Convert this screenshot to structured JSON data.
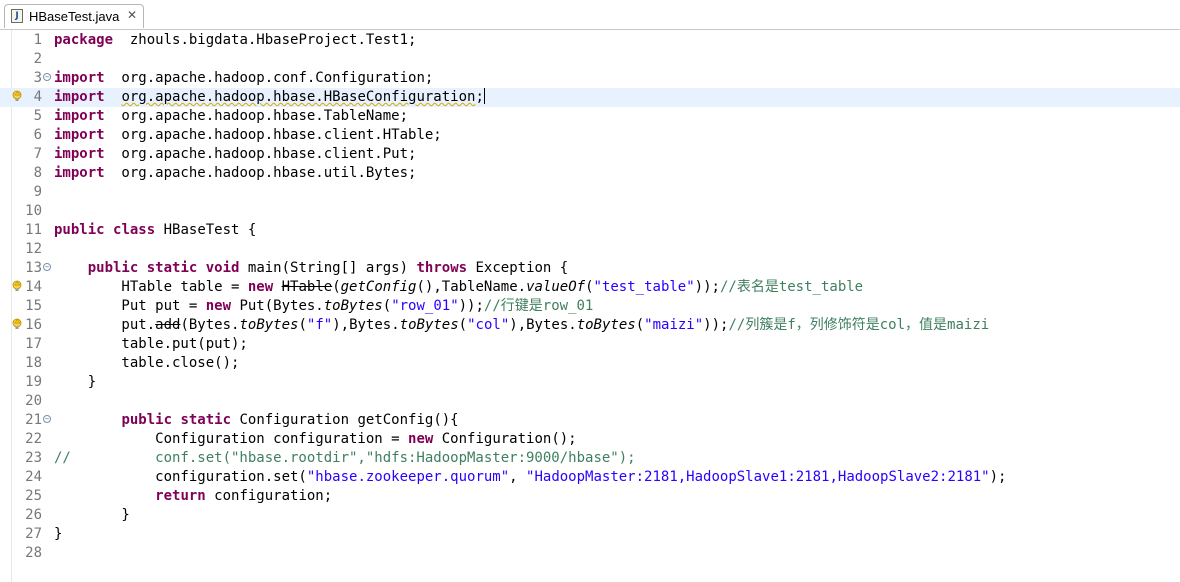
{
  "tab": {
    "title": "HBaseTest.java",
    "close": "✕"
  },
  "lines": [
    {
      "n": "1",
      "parts": [
        [
          "kw",
          "package"
        ],
        [
          "",
          "  zhouls.bigdata.HbaseProject.Test1;"
        ]
      ]
    },
    {
      "n": "2",
      "parts": []
    },
    {
      "n": "3",
      "fold": true,
      "parts": [
        [
          "kw",
          "import"
        ],
        [
          "",
          "  org.apache.hadoop.conf.Configuration;"
        ]
      ]
    },
    {
      "n": "4",
      "warn": true,
      "current": true,
      "parts": [
        [
          "kw",
          "import"
        ],
        [
          "",
          "  "
        ],
        [
          "squig",
          "org.apache.hadoop.hbase.HBaseConfiguration"
        ],
        [
          "",
          ";"
        ],
        [
          "caret",
          ""
        ]
      ]
    },
    {
      "n": "5",
      "parts": [
        [
          "kw",
          "import"
        ],
        [
          "",
          "  org.apache.hadoop.hbase.TableName;"
        ]
      ]
    },
    {
      "n": "6",
      "parts": [
        [
          "kw",
          "import"
        ],
        [
          "",
          "  org.apache.hadoop.hbase.client.HTable;"
        ]
      ]
    },
    {
      "n": "7",
      "parts": [
        [
          "kw",
          "import"
        ],
        [
          "",
          "  org.apache.hadoop.hbase.client.Put;"
        ]
      ]
    },
    {
      "n": "8",
      "parts": [
        [
          "kw",
          "import"
        ],
        [
          "",
          "  org.apache.hadoop.hbase.util.Bytes;"
        ]
      ]
    },
    {
      "n": "9",
      "parts": []
    },
    {
      "n": "10",
      "parts": []
    },
    {
      "n": "11",
      "parts": [
        [
          "kw",
          "public"
        ],
        [
          "",
          " "
        ],
        [
          "kw",
          "class"
        ],
        [
          "",
          " HBaseTest {"
        ]
      ]
    },
    {
      "n": "12",
      "parts": []
    },
    {
      "n": "13",
      "fold": true,
      "parts": [
        [
          "",
          "    "
        ],
        [
          "kw",
          "public"
        ],
        [
          "",
          " "
        ],
        [
          "kw",
          "static"
        ],
        [
          "",
          " "
        ],
        [
          "kw",
          "void"
        ],
        [
          "",
          " main(String[] args) "
        ],
        [
          "kw",
          "throws"
        ],
        [
          "",
          " Exception {"
        ]
      ]
    },
    {
      "n": "14",
      "warn": true,
      "parts": [
        [
          "",
          "        HTable table = "
        ],
        [
          "kw",
          "new"
        ],
        [
          "",
          " "
        ],
        [
          "strike",
          "HTable"
        ],
        [
          "",
          "("
        ],
        [
          "ital",
          "getConfig"
        ],
        [
          "",
          "(),TableName."
        ],
        [
          "ital",
          "valueOf"
        ],
        [
          "",
          "("
        ],
        [
          "str",
          "\"test_table\""
        ],
        [
          "",
          "));"
        ],
        [
          "cm",
          "//表名是test_table"
        ]
      ]
    },
    {
      "n": "15",
      "parts": [
        [
          "",
          "        Put put = "
        ],
        [
          "kw",
          "new"
        ],
        [
          "",
          " Put(Bytes."
        ],
        [
          "ital",
          "toBytes"
        ],
        [
          "",
          "("
        ],
        [
          "str",
          "\"row_01\""
        ],
        [
          "",
          "));"
        ],
        [
          "cm",
          "//行键是row_01"
        ]
      ]
    },
    {
      "n": "16",
      "warn": true,
      "parts": [
        [
          "",
          "        put."
        ],
        [
          "strike",
          "add"
        ],
        [
          "",
          "(Bytes."
        ],
        [
          "ital",
          "toBytes"
        ],
        [
          "",
          "("
        ],
        [
          "str",
          "\"f\""
        ],
        [
          "",
          "),Bytes."
        ],
        [
          "ital",
          "toBytes"
        ],
        [
          "",
          "("
        ],
        [
          "str",
          "\"col\""
        ],
        [
          "",
          "),Bytes."
        ],
        [
          "ital",
          "toBytes"
        ],
        [
          "",
          "("
        ],
        [
          "str",
          "\"maizi\""
        ],
        [
          "",
          "));"
        ],
        [
          "cm",
          "//列簇是f，列修饰符是col，值是maizi"
        ]
      ]
    },
    {
      "n": "17",
      "parts": [
        [
          "",
          "        table.put(put);"
        ]
      ]
    },
    {
      "n": "18",
      "parts": [
        [
          "",
          "        table.close();"
        ]
      ]
    },
    {
      "n": "19",
      "parts": [
        [
          "",
          "    }"
        ]
      ]
    },
    {
      "n": "20",
      "parts": []
    },
    {
      "n": "21",
      "fold": true,
      "parts": [
        [
          "",
          "        "
        ],
        [
          "kw",
          "public"
        ],
        [
          "",
          " "
        ],
        [
          "kw",
          "static"
        ],
        [
          "",
          " Configuration getConfig(){"
        ]
      ]
    },
    {
      "n": "22",
      "parts": [
        [
          "",
          "            Configuration configuration = "
        ],
        [
          "kw",
          "new"
        ],
        [
          "",
          " Configuration();"
        ]
      ]
    },
    {
      "n": "23",
      "parts": [
        [
          "cm",
          "//          conf.set(\"hbase.rootdir\",\"hdfs:HadoopMaster:9000/hbase\");"
        ]
      ]
    },
    {
      "n": "24",
      "parts": [
        [
          "",
          "            configuration.set("
        ],
        [
          "str",
          "\"hbase.zookeeper.quorum\""
        ],
        [
          "",
          ", "
        ],
        [
          "str",
          "\"HadoopMaster:2181,HadoopSlave1:2181,HadoopSlave2:2181\""
        ],
        [
          "",
          "); "
        ]
      ]
    },
    {
      "n": "25",
      "parts": [
        [
          "",
          "            "
        ],
        [
          "kw",
          "return"
        ],
        [
          "",
          " configuration;"
        ]
      ]
    },
    {
      "n": "26",
      "parts": [
        [
          "",
          "        }"
        ]
      ]
    },
    {
      "n": "27",
      "parts": [
        [
          "",
          "}"
        ]
      ]
    },
    {
      "n": "28",
      "parts": []
    }
  ]
}
